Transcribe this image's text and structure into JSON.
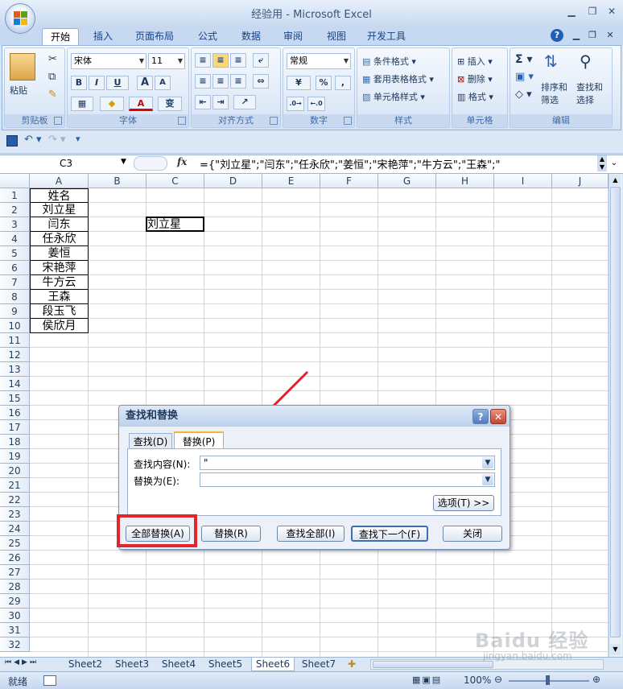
{
  "window": {
    "title": "经验用 - Microsoft Excel"
  },
  "ribbon_tabs": [
    "开始",
    "插入",
    "页面布局",
    "公式",
    "数据",
    "审阅",
    "视图",
    "开发工具"
  ],
  "ribbon": {
    "clipboard": {
      "label": "剪贴板",
      "paste": "粘贴"
    },
    "font": {
      "label": "字体",
      "name": "宋体",
      "size": "11",
      "bold": "B",
      "italic": "I",
      "underline": "U",
      "grow": "A",
      "shrink": "A",
      "color_letter": "A",
      "phonetic": "变"
    },
    "alignment": {
      "label": "对齐方式"
    },
    "number": {
      "label": "数字",
      "format": "常规",
      "percent": "%",
      "comma": ","
    },
    "styles": {
      "label": "样式",
      "cond_format": "条件格式",
      "table_format": "套用表格格式",
      "cell_styles": "单元格样式"
    },
    "cells": {
      "label": "单元格",
      "insert": "插入",
      "delete": "删除",
      "format": "格式"
    },
    "editing": {
      "label": "编辑",
      "sort_filter_1": "排序和",
      "sort_filter_2": "筛选",
      "find_select_1": "查找和",
      "find_select_2": "选择"
    }
  },
  "formula_bar": {
    "name_box": "C3",
    "fx": "fx",
    "formula": "={\"刘立星\";\"闫东\";\"任永欣\";\"姜恒\";\"宋艳萍\";\"牛方云\";\"王森\";\""
  },
  "columns": [
    "A",
    "B",
    "C",
    "D",
    "E",
    "F",
    "G",
    "H",
    "I",
    "J"
  ],
  "rows": [
    "1",
    "2",
    "3",
    "4",
    "5",
    "6",
    "7",
    "8",
    "9",
    "10",
    "11",
    "12",
    "13",
    "14",
    "15",
    "16",
    "17",
    "18",
    "19",
    "20",
    "21",
    "22",
    "23",
    "24",
    "25",
    "26",
    "27",
    "28",
    "29",
    "30",
    "31",
    "32"
  ],
  "column_a": [
    "姓名",
    "刘立星",
    "闫东",
    "任永欣",
    "姜恒",
    "宋艳萍",
    "牛方云",
    "王森",
    "段玉飞",
    "侯欣月"
  ],
  "cell_c3": "刘立星",
  "dialog": {
    "title": "查找和替换",
    "help": "?",
    "close_x": "✕",
    "tab_find": "查找(D)",
    "tab_replace": "替换(P)",
    "find_label": "查找内容(N):",
    "find_value": "\"",
    "replace_label": "替换为(E):",
    "replace_value": "",
    "options": "选项(T) >>",
    "replace_all": "全部替换(A)",
    "replace": "替换(R)",
    "find_all": "查找全部(I)",
    "find_next": "查找下一个(F)",
    "close": "关闭"
  },
  "sheets": [
    "Sheet2",
    "Sheet3",
    "Sheet4",
    "Sheet5",
    "Sheet6",
    "Sheet7"
  ],
  "active_sheet": "Sheet6",
  "status": {
    "ready": "就绪",
    "zoom": "100%"
  },
  "watermark": {
    "line1": "Baidu 经验",
    "line2": "jingyan.baidu.com"
  },
  "colors": {
    "highlight": "#e2252b",
    "arrow": "#e2252b",
    "ribbon_bg": "#dce8f7",
    "tab_text": "#15428b"
  }
}
